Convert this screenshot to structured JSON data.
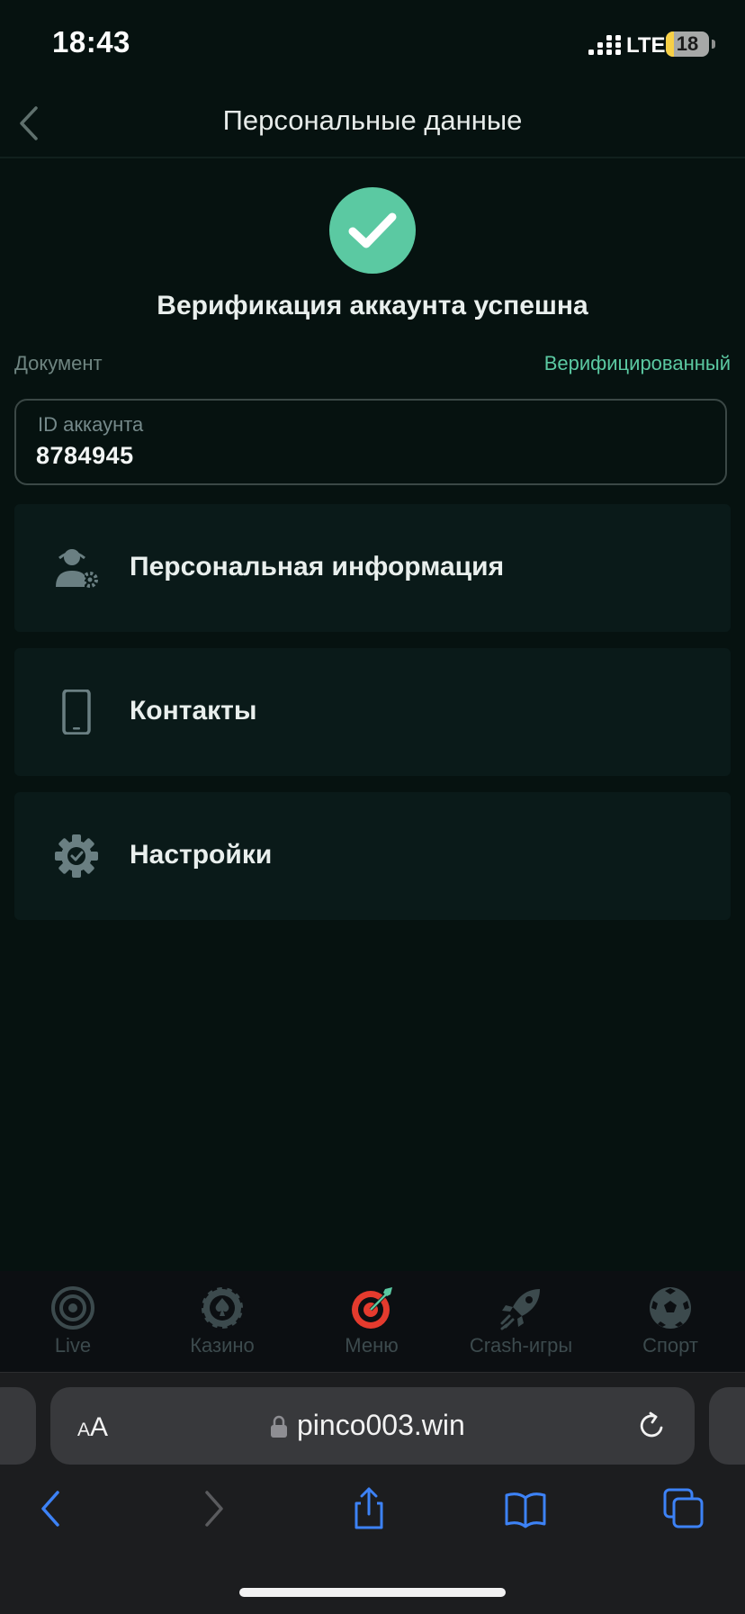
{
  "status_bar": {
    "time": "18:43",
    "network": "LTE",
    "battery_level": "18",
    "battery_fraction": 0.18
  },
  "header": {
    "title": "Персональные данные",
    "back_icon": "chevron-left-icon"
  },
  "verification": {
    "icon": "check-circle-icon",
    "message": "Верификация аккаунта успешна",
    "document_label": "Документ",
    "document_status": "Верифицированный"
  },
  "account_id": {
    "label": "ID аккаунта",
    "value": "8784945"
  },
  "menu": [
    {
      "label": "Персональная информация",
      "icon": "user-settings-icon"
    },
    {
      "label": "Контакты",
      "icon": "phone-icon"
    },
    {
      "label": "Настройки",
      "icon": "gear-check-icon"
    }
  ],
  "bottom_nav": [
    {
      "label": "Live",
      "icon": "live-target-icon"
    },
    {
      "label": "Казино",
      "icon": "casino-chip-icon"
    },
    {
      "label": "Меню",
      "icon": "dart-target-icon"
    },
    {
      "label": "Crash-игры",
      "icon": "rocket-icon"
    },
    {
      "label": "Спорт",
      "icon": "soccer-ball-icon"
    }
  ],
  "browser": {
    "text_size_label": "AA",
    "url": "pinco003.win"
  },
  "colors": {
    "background": "#061210",
    "accent_green": "#5bc9a2",
    "card": "#0a1a19",
    "menu_red": "#e53b2e",
    "safari_blue": "#3d82f6"
  }
}
